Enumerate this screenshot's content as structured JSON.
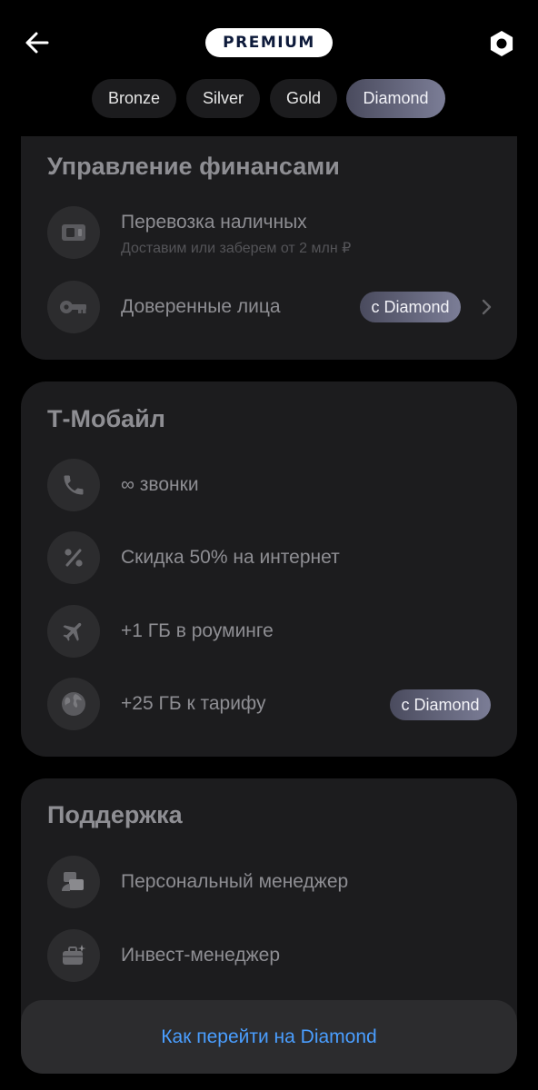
{
  "header": {
    "back_icon": "arrow-left-icon",
    "logo_text": "PREMIUM",
    "settings_icon": "hexagon-nut-icon"
  },
  "tabs": [
    {
      "label": "Bronze",
      "active": false
    },
    {
      "label": "Silver",
      "active": false
    },
    {
      "label": "Gold",
      "active": false
    },
    {
      "label": "Diamond",
      "active": true
    }
  ],
  "finance": {
    "title": "Управление финансами",
    "items": [
      {
        "icon": "cash-icon",
        "title": "Перевозка наличных",
        "subtitle": "Доставим или заберем от 2 млн ₽"
      },
      {
        "icon": "key-icon",
        "title": "Доверенные лица",
        "badge": "с Diamond"
      }
    ]
  },
  "mobile": {
    "title": "Т‑Мобайл",
    "items": [
      {
        "icon": "phone-icon",
        "title": "∞ звонки"
      },
      {
        "icon": "percent-icon",
        "title": "Скидка 50% на интернет"
      },
      {
        "icon": "airplane-icon",
        "title": "+1 ГБ в роуминге"
      },
      {
        "icon": "globe-icon",
        "title": "+25 ГБ к тарифу",
        "badge": "с Diamond"
      }
    ]
  },
  "support": {
    "title": "Поддержка",
    "items": [
      {
        "icon": "manager-icon",
        "title": "Персональный менеджер"
      },
      {
        "icon": "briefcase-icon",
        "title": "Инвест-менеджер"
      }
    ]
  },
  "bottom_button": {
    "label": "Как перейти на Diamond"
  },
  "colors": {
    "accent_link": "#4a9eff",
    "card_bg": "#1c1c1e",
    "badge_gradient_start": "#4a4b5e",
    "badge_gradient_end": "#7b7d96"
  }
}
